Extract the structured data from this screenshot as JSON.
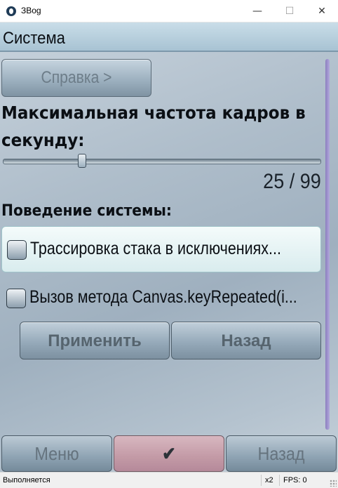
{
  "window": {
    "title": "ЗBog",
    "minimize_glyph": "—",
    "maximize_glyph": "☐",
    "close_glyph": "✕"
  },
  "header": {
    "title": "Система"
  },
  "help_button": {
    "label": "Справка >"
  },
  "fps_setting": {
    "label_line1": "Максимальная частота кадров в",
    "label_line2": "секунду:",
    "value": 25,
    "max": 99,
    "value_text": "25 / 99"
  },
  "system_behavior": {
    "label": "Поведение системы:",
    "options": [
      {
        "label": "Трассировка стака в исключениях...",
        "checked": false,
        "focused": true
      },
      {
        "label": "Вызов метода Canvas.keyRepeated(i...",
        "checked": false,
        "focused": false
      }
    ]
  },
  "actions": {
    "apply": "Применить",
    "back": "Назад"
  },
  "softkeys": {
    "menu": "Меню",
    "ok": "✔",
    "back": "Назад"
  },
  "statusbar": {
    "text": "Выполняется",
    "scale": "x2",
    "fps": "FPS: 0"
  },
  "colors": {
    "header_bg": "#b9d1de",
    "accent_scrollbar": "#9a8fcf",
    "ok_button": "#c8a0ab",
    "focused_row": "#e6f4f5"
  }
}
